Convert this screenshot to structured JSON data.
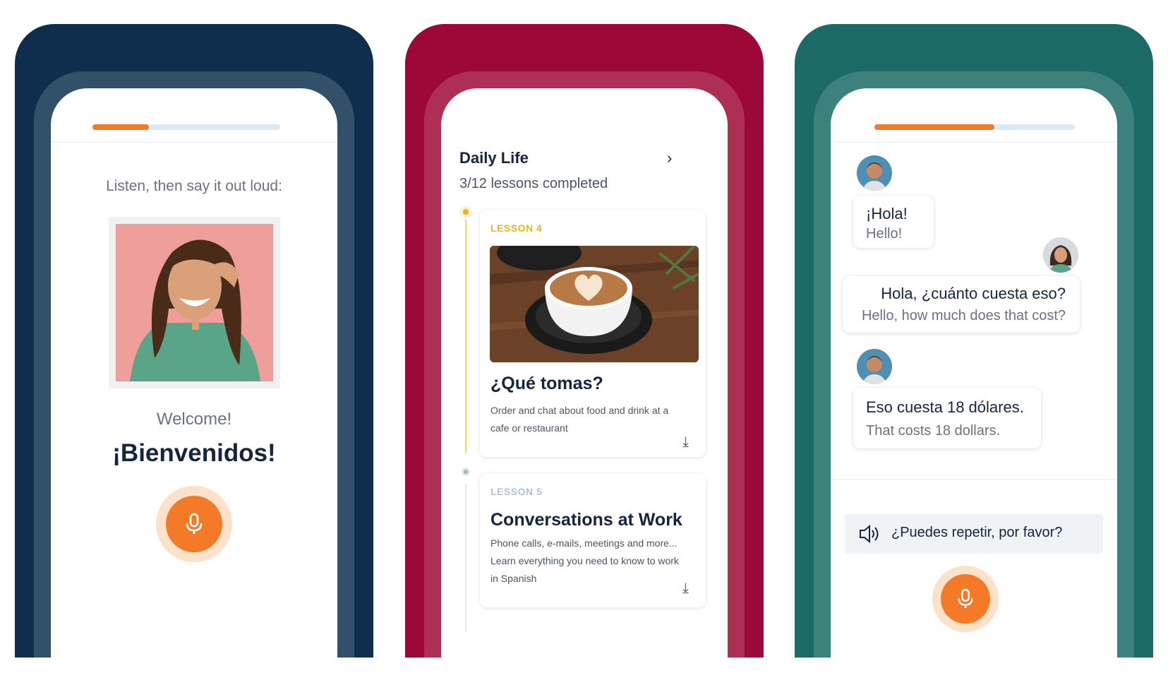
{
  "screen1": {
    "progress": 0.3,
    "prompt": "Listen, then say it out loud:",
    "welcome": "Welcome!",
    "title": "¡Bienvenidos!",
    "mic_icon": "microphone-icon"
  },
  "screen2": {
    "section_title": "Daily Life",
    "chevron_icon": "chevron-right-icon",
    "completed": "3/12 lessons completed",
    "lessons": [
      {
        "tag": "LESSON 4",
        "title": "¿Qué tomas?",
        "description": "Order and chat about food and drink at a cafe or restaurant",
        "download_icon": "download-icon"
      },
      {
        "tag": "LESSON 5",
        "title": "Conversations at Work",
        "description": "Phone calls, e-mails, meetings and more... Learn everything you need to know to work in Spanish",
        "download_icon": "download-icon"
      }
    ]
  },
  "screen3": {
    "progress": 0.6,
    "messages": [
      {
        "spanish": "¡Hola!",
        "english": "Hello!"
      },
      {
        "spanish": "Hola, ¿cuánto cuesta eso?",
        "english": "Hello, how much does that cost?"
      },
      {
        "spanish": "Eso cuesta 18 dólares.",
        "english": "That costs 18 dollars."
      }
    ],
    "prompt": "¿Puedes repetir, por favor?",
    "speaker_icon": "speaker-icon",
    "mic_icon": "microphone-icon"
  },
  "colors": {
    "panel1": "#0f2e4d",
    "panel2": "#9c0838",
    "panel3": "#1b6a68",
    "accent": "#f47a27",
    "lesson_active": "#e8b51a",
    "lesson_inactive": "#a7b3c0"
  }
}
